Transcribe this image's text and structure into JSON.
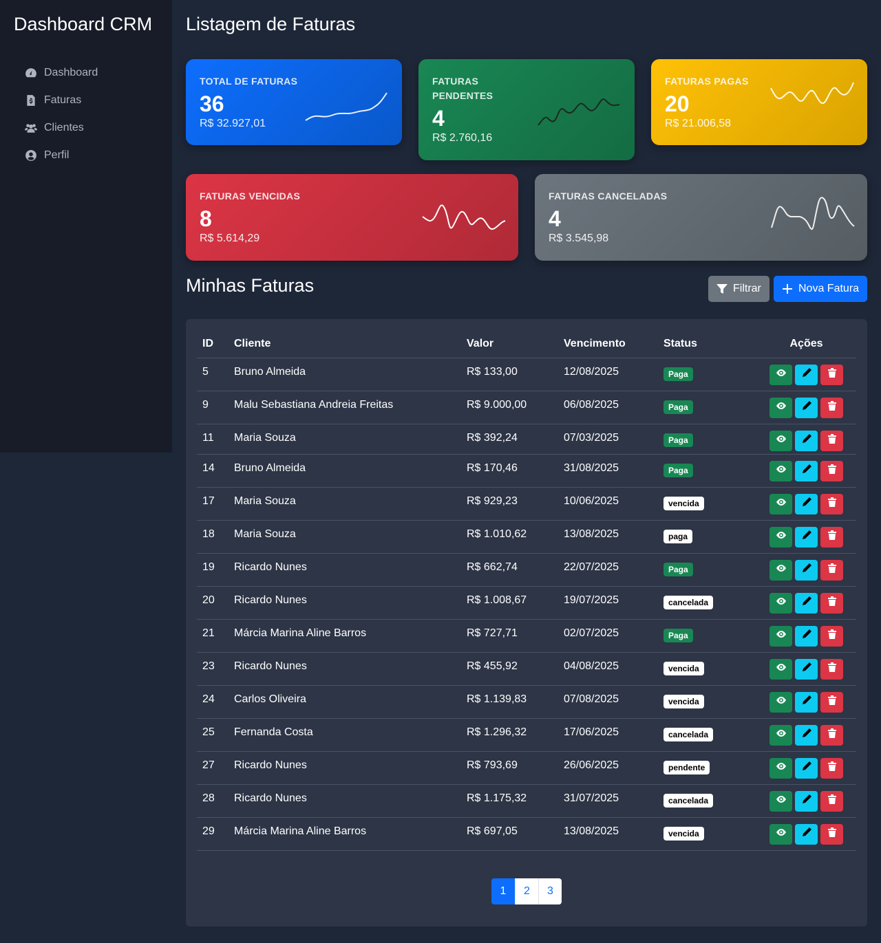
{
  "sidebar": {
    "brand": "Dashboard CRM",
    "items": [
      {
        "label": "Dashboard",
        "icon": "gauge-icon"
      },
      {
        "label": "Faturas",
        "icon": "file-invoice-dollar-icon"
      },
      {
        "label": "Clientes",
        "icon": "users-icon"
      },
      {
        "label": "Perfil",
        "icon": "user-circle-icon"
      }
    ]
  },
  "page_title": "Listagem de Faturas",
  "cards": [
    {
      "label": "TOTAL DE FATURAS",
      "count": "36",
      "amount": "R$ 32.927,01",
      "color": "#0d6efd"
    },
    {
      "label": "FATURAS PENDENTES",
      "count": "4",
      "amount": "R$ 2.760,16",
      "color": "#198754"
    },
    {
      "label": "FATURAS PAGAS",
      "count": "20",
      "amount": "R$ 21.006,58",
      "color": "#ffc107"
    },
    {
      "label": "FATURAS VENCIDAS",
      "count": "8",
      "amount": "R$ 5.614,29",
      "color": "#dc3545"
    },
    {
      "label": "FATURAS CANCELADAS",
      "count": "4",
      "amount": "R$ 3.545,98",
      "color": "#6c757d"
    }
  ],
  "section_title": "Minhas Faturas",
  "buttons": {
    "filter": "Filtrar",
    "new": "Nova Fatura"
  },
  "table": {
    "headers": [
      "ID",
      "Cliente",
      "Valor",
      "Vencimento",
      "Status",
      "Ações"
    ],
    "rows": [
      [
        "5",
        "Bruno Almeida",
        "R$ 133,00",
        "12/08/2025",
        "Paga"
      ],
      [
        "9",
        "Malu Sebastiana Andreia Freitas",
        "R$ 9.000,00",
        "06/08/2025",
        "Paga"
      ],
      [
        "11",
        "Maria Souza",
        "R$ 392,24",
        "07/03/2025",
        "Paga"
      ],
      [
        "14",
        "Bruno Almeida",
        "R$ 170,46",
        "31/08/2025",
        "Paga"
      ],
      [
        "17",
        "Maria Souza",
        "R$ 929,23",
        "10/06/2025",
        "vencida"
      ],
      [
        "18",
        "Maria Souza",
        "R$ 1.010,62",
        "13/08/2025",
        "paga"
      ],
      [
        "19",
        "Ricardo Nunes",
        "R$ 662,74",
        "22/07/2025",
        "Paga"
      ],
      [
        "20",
        "Ricardo Nunes",
        "R$ 1.008,67",
        "19/07/2025",
        "cancelada"
      ],
      [
        "21",
        "Márcia Marina Aline Barros",
        "R$ 727,71",
        "02/07/2025",
        "Paga"
      ],
      [
        "23",
        "Ricardo Nunes",
        "R$ 455,92",
        "04/08/2025",
        "vencida"
      ],
      [
        "24",
        "Carlos Oliveira",
        "R$ 1.139,83",
        "07/08/2025",
        "vencida"
      ],
      [
        "25",
        "Fernanda Costa",
        "R$ 1.296,32",
        "17/06/2025",
        "cancelada"
      ],
      [
        "27",
        "Ricardo Nunes",
        "R$ 793,69",
        "26/06/2025",
        "pendente"
      ],
      [
        "28",
        "Ricardo Nunes",
        "R$ 1.175,32",
        "31/07/2025",
        "cancelada"
      ],
      [
        "29",
        "Márcia Marina Aline Barros",
        "R$ 697,05",
        "13/08/2025",
        "vencida"
      ]
    ]
  },
  "pagination": {
    "pages": [
      "1",
      "2",
      "3"
    ],
    "current": "1"
  }
}
